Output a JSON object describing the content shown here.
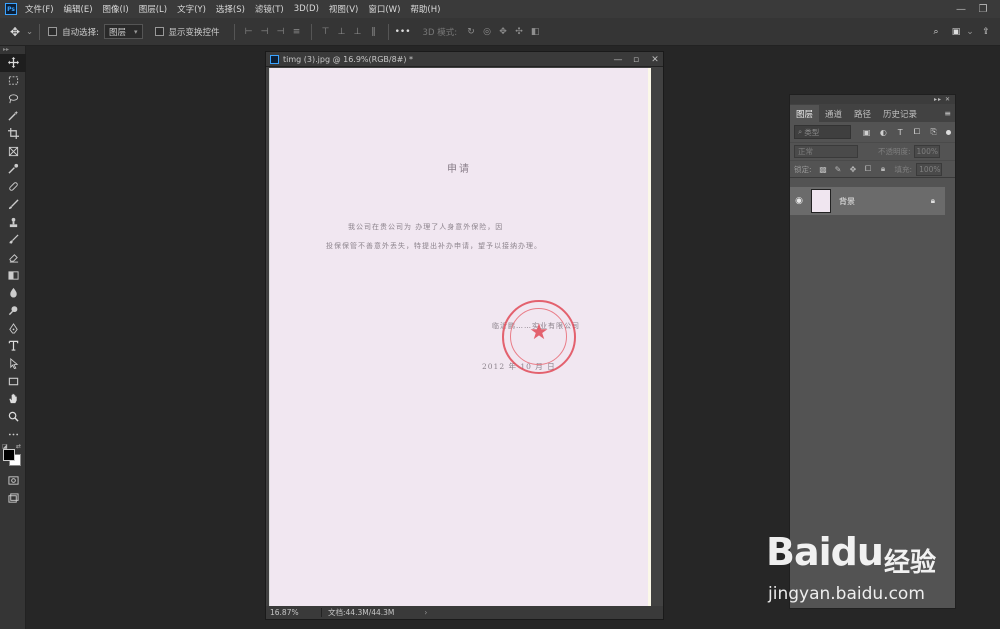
{
  "menubar": {
    "app_logo": "Ps",
    "items": [
      "文件(F)",
      "编辑(E)",
      "图像(I)",
      "图层(L)",
      "文字(Y)",
      "选择(S)",
      "滤镜(T)",
      "3D(D)",
      "视图(V)",
      "窗口(W)",
      "帮助(H)"
    ],
    "window_controls": [
      "—",
      "❐"
    ]
  },
  "options": {
    "auto_select_label": "自动选择:",
    "auto_select_target": "图层",
    "show_transform_label": "显示变换控件",
    "mode_3d_label": "3D 模式:"
  },
  "document": {
    "title": "timg (3).jpg @ 16.9%(RGB/8#) *",
    "heading": "申请",
    "line1": "我公司在贵公司为                办理了人身意外保险，因",
    "line2": "投保保管不善意外丢失，特提出补办申请，望予以接纳办理。",
    "signature": "临沂鹏……实业有限公司",
    "date": "2012  年  10  月   日",
    "zoom": "16.87%",
    "doc_size": "文档:44.3M/44.3M"
  },
  "layers_panel": {
    "tabs": [
      "图层",
      "通道",
      "路径",
      "历史记录"
    ],
    "filter_placeholder": "类型",
    "blend_mode": "正常",
    "opacity_label": "不透明度:",
    "opacity_value": "100%",
    "lock_label": "锁定:",
    "fill_label": "填充:",
    "fill_value": "100%",
    "layer_name": "背景"
  },
  "watermark": {
    "brand": "Baidu",
    "brand_cn": "经验",
    "url": "jingyan.baidu.com"
  },
  "colors": {
    "accent": "#3aa3ff",
    "paper": "#f1e7f1",
    "stamp": "#e14a58"
  }
}
